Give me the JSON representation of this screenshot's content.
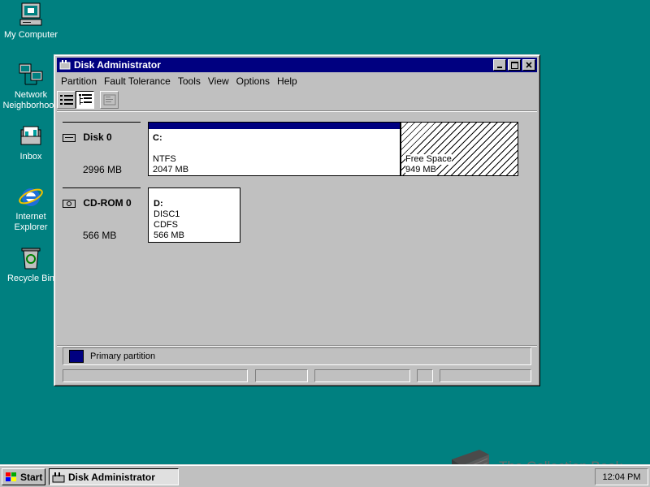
{
  "desktop": {
    "icons": [
      {
        "label": "My Computer"
      },
      {
        "label": "Network Neighborhood"
      },
      {
        "label": "Inbox"
      },
      {
        "label": "Internet Explorer"
      },
      {
        "label": "Recycle Bin"
      }
    ]
  },
  "window": {
    "title": "Disk Administrator",
    "menu": [
      "Partition",
      "Fault Tolerance",
      "Tools",
      "View",
      "Options",
      "Help"
    ],
    "disks": [
      {
        "name": "Disk 0",
        "size": "2996 MB",
        "partitions": [
          {
            "letter": "C:",
            "fs": "NTFS",
            "size": "2047 MB"
          },
          {
            "label": "Free Space",
            "size": "949 MB"
          }
        ]
      },
      {
        "name": "CD-ROM 0",
        "size": "566 MB",
        "partitions": [
          {
            "letter": "D:",
            "volume": "DISC1",
            "fs": "CDFS",
            "size": "566 MB"
          }
        ]
      }
    ],
    "legend": {
      "label": "Primary partition",
      "color": "#000080"
    }
  },
  "taskbar": {
    "start_label": "Start",
    "task_label": "Disk Administrator",
    "clock": "12:04 PM"
  },
  "watermark": {
    "text": "The Collection Book"
  },
  "colors": {
    "desktop": "#008080",
    "titlebar": "#000080",
    "face": "#c0c0c0"
  }
}
